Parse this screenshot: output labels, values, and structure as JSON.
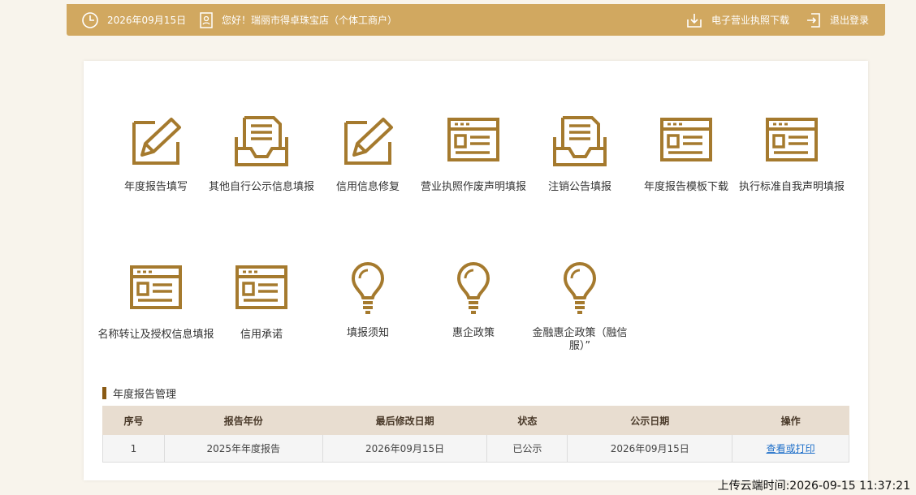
{
  "header": {
    "date": "2026年09月15日",
    "greeting": "您好！瑞丽市得卓珠宝店（个体工商户）",
    "download_label": "电子营业执照下载",
    "logout_label": "退出登录"
  },
  "tiles": [
    {
      "label": "年度报告填写",
      "icon": "edit-form-icon"
    },
    {
      "label": "其他自行公示信息填报",
      "icon": "document-tray-icon"
    },
    {
      "label": "信用信息修复",
      "icon": "edit-form-icon"
    },
    {
      "label": "营业执照作废声明填报",
      "icon": "browser-window-icon"
    },
    {
      "label": "注销公告填报",
      "icon": "document-tray-icon"
    },
    {
      "label": "年度报告模板下载",
      "icon": "browser-window-icon"
    },
    {
      "label": "执行标准自我声明填报",
      "icon": "browser-window-icon"
    },
    {
      "label": "名称转让及授权信息填报",
      "icon": "browser-window-icon"
    },
    {
      "label": "信用承诺",
      "icon": "browser-window-icon"
    },
    {
      "label": "填报须知",
      "icon": "lightbulb-icon"
    },
    {
      "label": "惠企政策",
      "icon": "lightbulb-icon"
    },
    {
      "label": "金融惠企政策（融信服）”",
      "icon": "lightbulb-icon"
    }
  ],
  "report_section": {
    "title": "年度报告管理",
    "columns": [
      "序号",
      "报告年份",
      "最后修改日期",
      "状态",
      "公示日期",
      "操作"
    ],
    "rows": [
      {
        "index": "1",
        "year": "2025年年度报告",
        "modified": "2026年09月15日",
        "status": "已公示",
        "publish_date": "2026年09月15日",
        "action": "查看或打印"
      }
    ]
  },
  "upload_time": "上传云端时间:2026-09-15 11:37:21",
  "colors": {
    "accent": "#d1a860",
    "icon": "#a57a2e",
    "link": "#1e6fc9"
  }
}
